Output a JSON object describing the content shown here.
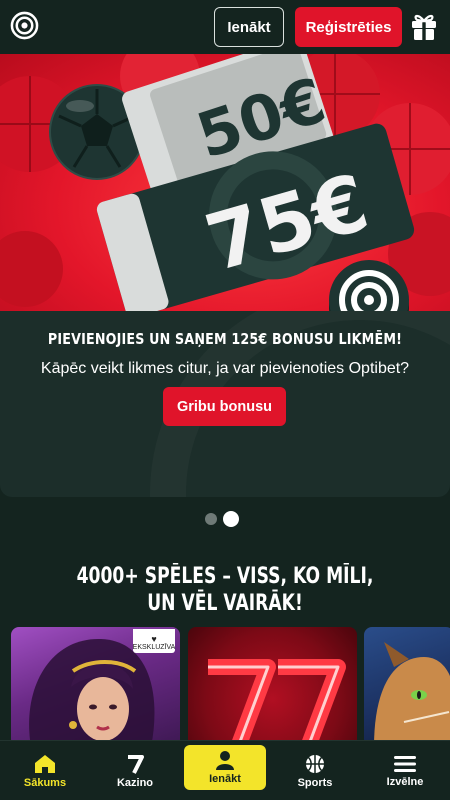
{
  "header": {
    "logo_icon": "target-logo-icon",
    "login_label": "Ienākt",
    "register_label": "Reģistrēties",
    "gift_icon": "gift-icon"
  },
  "promo": {
    "ticket_small_amount": "50€",
    "ticket_big_amount": "75€",
    "title": "PIEVIENOJIES UN SAŅEM 125€ BONUSU LIKMĒM!",
    "subtitle": "Kāpēc veikt likmes citur, ja var pievienoties Optibet?",
    "cta_label": "Gribu bonusu",
    "carousel_slides": 2,
    "active_slide": 2
  },
  "games": {
    "title_line1": "4000+ SPĒLES – VISS, KO MĪLI,",
    "title_line2": "UN VĒL VAIRĀK!",
    "exclusive_badge": "EKSKLUZĪVA"
  },
  "bottom_nav": {
    "items": [
      {
        "label": "Sākums",
        "icon": "home-icon",
        "active": true
      },
      {
        "label": "Kazino",
        "icon": "seven-icon"
      },
      {
        "label": "Ienākt",
        "icon": "user-icon"
      },
      {
        "label": "Sports",
        "icon": "basketball-icon"
      },
      {
        "label": "Izvēlne",
        "icon": "menu-icon"
      }
    ]
  },
  "colors": {
    "background": "#14241f",
    "accent_red": "#e0142a",
    "accent_yellow": "#f3e42a"
  }
}
